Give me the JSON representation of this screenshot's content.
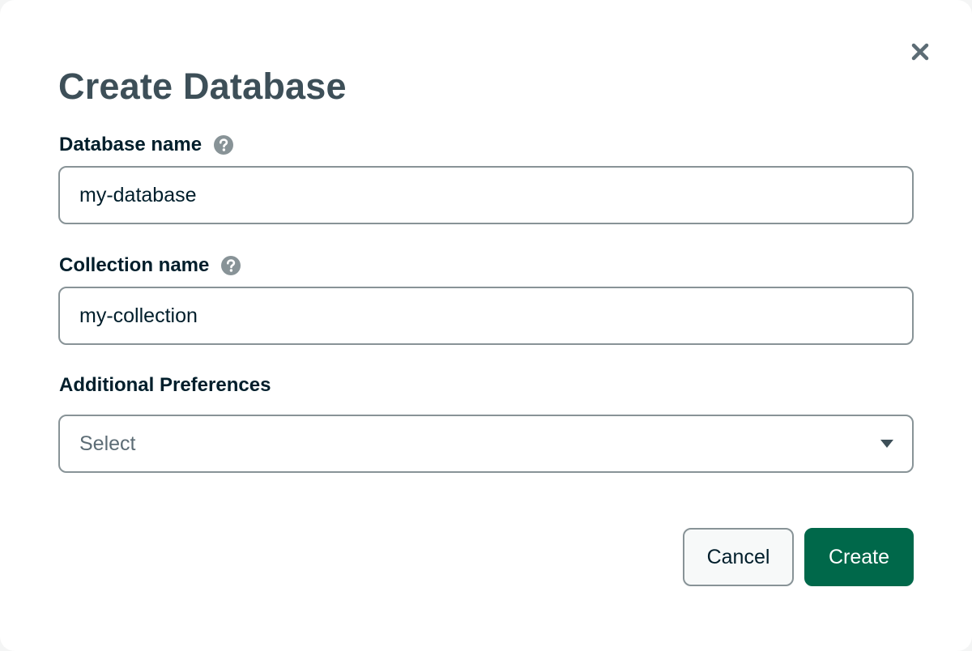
{
  "dialog": {
    "title": "Create Database",
    "close_icon": "close-icon"
  },
  "fields": {
    "database_name": {
      "label": "Database name",
      "value": "my-database",
      "help_icon": "question-circle-icon"
    },
    "collection_name": {
      "label": "Collection name",
      "value": "my-collection",
      "help_icon": "question-circle-icon"
    },
    "additional_preferences": {
      "label": "Additional Preferences",
      "placeholder": "Select",
      "icon": "caret-down-icon"
    }
  },
  "actions": {
    "cancel_label": "Cancel",
    "create_label": "Create"
  },
  "colors": {
    "primary": "#00684a",
    "heading": "#3d4f58",
    "label": "#001e2b",
    "border": "#889397",
    "icon": "#889397"
  }
}
